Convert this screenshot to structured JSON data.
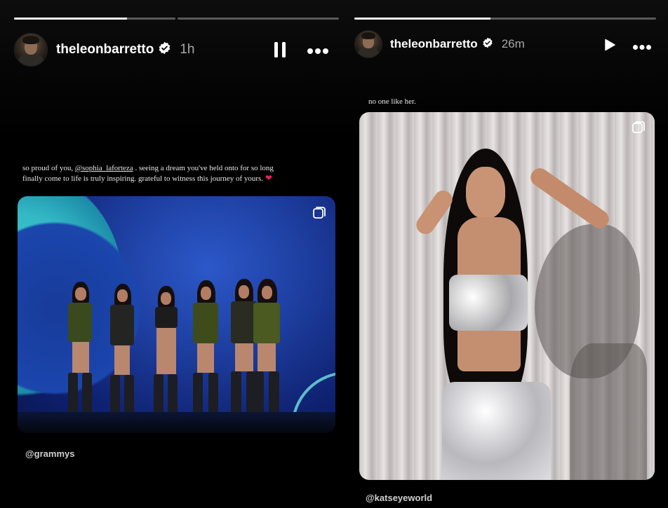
{
  "left_story": {
    "progress": [
      0.7,
      0.0
    ],
    "username": "theleonbarretto",
    "time": "1h",
    "caption_before": "so proud of you, ",
    "caption_mention": "@sophia_laforteza",
    "caption_after": " . seeing a dream you've held onto for so long finally come to life is truly inspiring. grateful to witness this journey of yours.",
    "caption_emoji": "❤️",
    "handle": "@grammys",
    "controls": {
      "pause": "pause-icon",
      "more": "more-icon"
    }
  },
  "right_story": {
    "progress": [
      0.45
    ],
    "username": "theleonbarretto",
    "time": "26m",
    "caption": "no one like her.",
    "handle": "@katseyeworld",
    "controls": {
      "play": "play-icon",
      "more": "more-icon"
    }
  },
  "colors": {
    "background": "#000000",
    "progress_track": "#5a5a5a",
    "progress_fill": "#f2f2f2",
    "muted_text": "#a8a8a8",
    "heart": "#e0245e"
  }
}
